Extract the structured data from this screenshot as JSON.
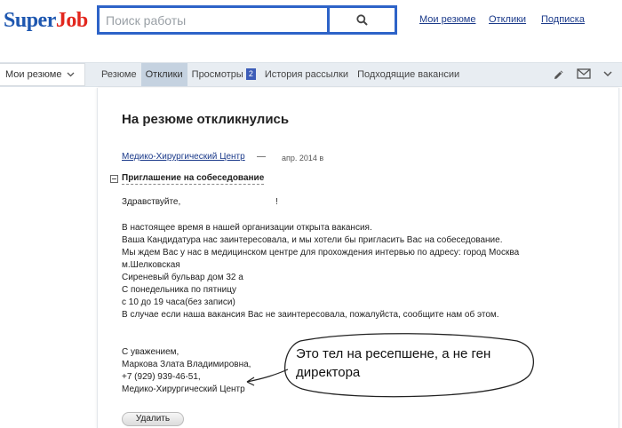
{
  "header": {
    "logo_part1": "Super",
    "logo_part2": "Job",
    "search_placeholder": "Поиск работы",
    "nav": [
      "Мои резюме",
      "Отклики",
      "Подписка"
    ]
  },
  "tabbar": {
    "resume_dropdown": "Мои резюме",
    "tabs": [
      {
        "label": "Резюме",
        "active": false
      },
      {
        "label": "Отклики",
        "active": true
      },
      {
        "label": "Просмотры",
        "active": false,
        "badge": "2"
      },
      {
        "label": "История рассылки",
        "active": false
      },
      {
        "label": "Подходящие вакансии",
        "active": false
      }
    ]
  },
  "main": {
    "title": "На резюме откликнулись",
    "company": "Медико-Хирургический Центр",
    "dash": "—",
    "date": "апр. 2014 в",
    "invitation_title": "Приглашение на собеседование",
    "greeting": "Здравствуйте,",
    "greeting_end": "!",
    "body": [
      "В настоящее время в нашей организации открыта вакансия.",
      "Ваша Кандидатура нас заинтересовала, и мы хотели бы пригласить Вас на собеседование.",
      "Мы ждем Вас у нас в медицинском центре для прохождения интервью по адресу: город Москва",
      "м.Шелковская",
      "Сиреневый бульвар дом 32 а",
      "С понедельника по пятницу",
      "с 10 до 19 часа(без записи)",
      "В случае если наша вакансия Вас не заинтересовала, пожалуйста, сообщите нам об этом."
    ],
    "signature": [
      "С уважением,",
      "Маркова Злата Владимировна,",
      "+7 (929) 939-46-51,",
      "Медико-Хирургический Центр"
    ],
    "delete_label": "Удалить"
  },
  "annotation": {
    "line1": "Это тел на ресепшене, а не ген",
    "line2": "директора"
  },
  "colors": {
    "logo_blue": "#1e57b0",
    "logo_red": "#e2261d",
    "search_border": "#2d63c8",
    "link": "#1b3a8a",
    "badge": "#3d5db8"
  }
}
